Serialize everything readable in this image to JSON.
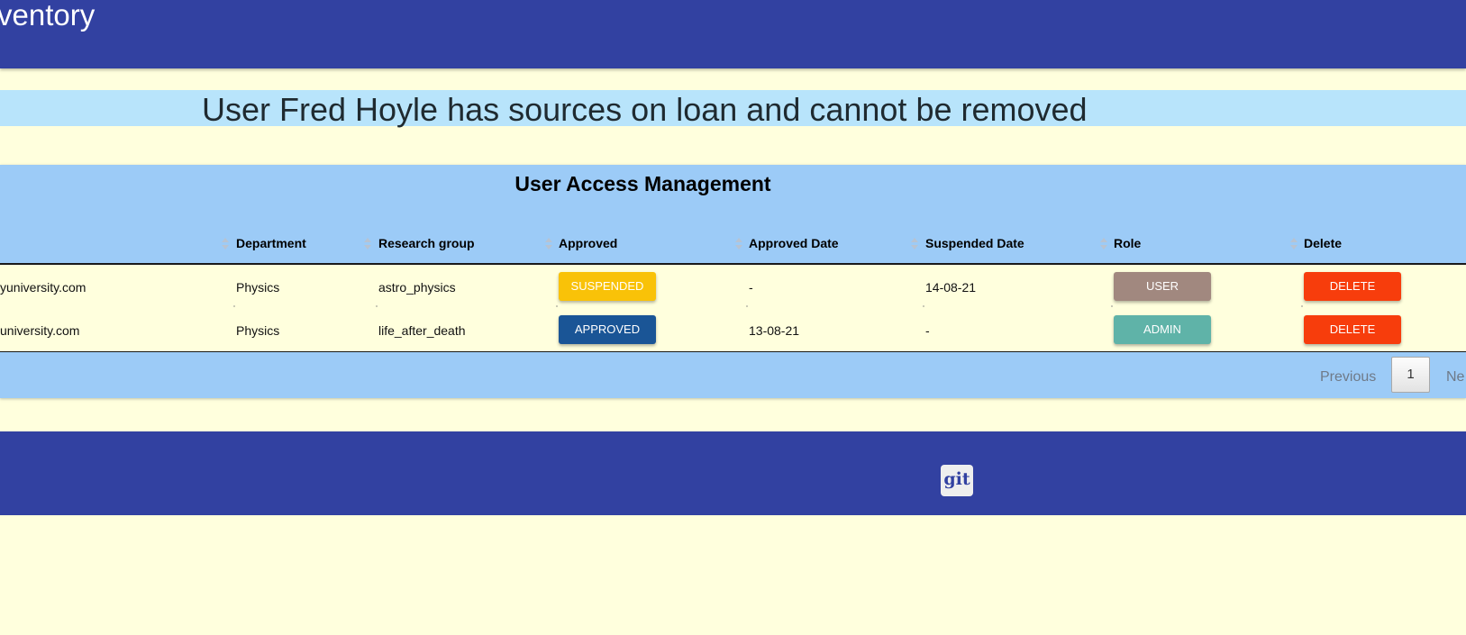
{
  "header": {
    "brand": "ventory"
  },
  "alert": {
    "message": "User Fred Hoyle has sources on loan and cannot be removed"
  },
  "table": {
    "title": "User Access Management",
    "columns": [
      "Department",
      "Research group",
      "Approved",
      "Approved Date",
      "Suspended Date",
      "Role",
      "Delete"
    ],
    "rows": [
      {
        "email": "yuniversity.com",
        "department": "Physics",
        "research_group": "astro_physics",
        "approved": "SUSPENDED",
        "approved_date": "-",
        "suspended_date": "14-08-21",
        "role": "USER",
        "delete": "DELETE"
      },
      {
        "email": "university.com",
        "department": "Physics",
        "research_group": "life_after_death",
        "approved": "APPROVED",
        "approved_date": "13-08-21",
        "suspended_date": "-",
        "role": "ADMIN",
        "delete": "DELETE"
      }
    ]
  },
  "pagination": {
    "previous": "Previous",
    "current_page": "1",
    "next": "Ne"
  },
  "footer": {
    "git_label": "git"
  },
  "colors": {
    "nav": "#3241a1",
    "background": "#ffffdd",
    "alert": "#b8e4fb",
    "panel": "#9ccbf7",
    "suspended": "#f9c208",
    "approved": "#1a5596",
    "user_role": "#a1887f",
    "admin_role": "#5fb3a8",
    "delete": "#f73d0c"
  }
}
